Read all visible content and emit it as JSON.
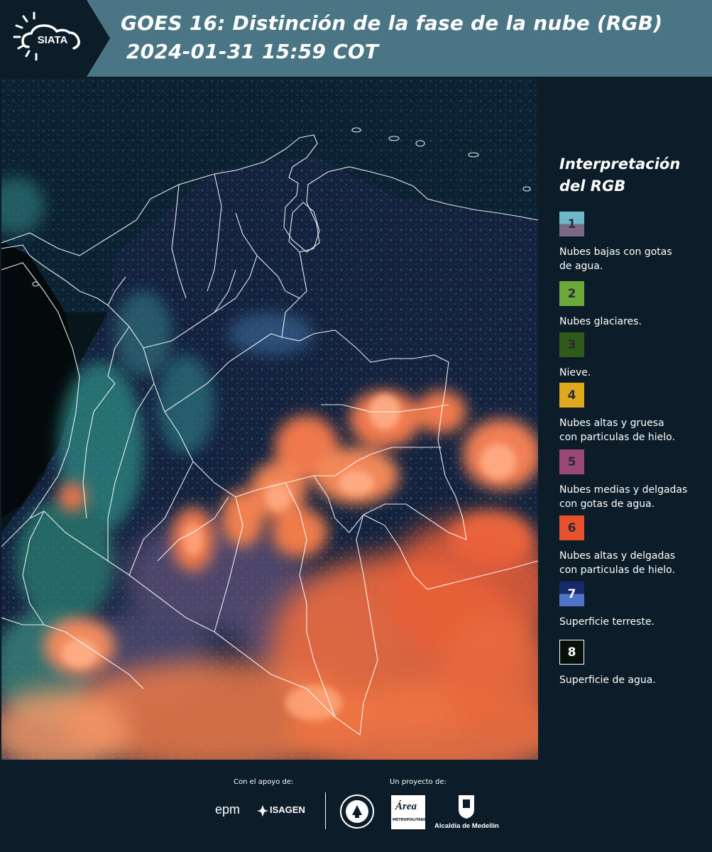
{
  "header": {
    "logo_text": "SIATA",
    "title_line1": "GOES 16: Distinción de la fase de la nube (RGB)",
    "title_line2": "2024-01-31 15:59 COT",
    "background_color": "#4a7585"
  },
  "legend": {
    "title_line1": "Interpretación",
    "title_line2": "del RGB",
    "items": [
      {
        "number": "1",
        "label_line1": "Nubes bajas con gotas",
        "label_line2": "de agua.",
        "colors": [
          "#6fb8c9",
          "#7b6a86"
        ]
      },
      {
        "number": "2",
        "label_line1": "Nubes glaciares.",
        "label_line2": "",
        "colors": [
          "#6aa93a"
        ]
      },
      {
        "number": "3",
        "label_line1": "Nieve.",
        "label_line2": "",
        "colors": [
          "#2f5a1c"
        ]
      },
      {
        "number": "4",
        "label_line1": "Nubes altas y gruesa",
        "label_line2": "con particulas de hielo.",
        "colors": [
          "#e0a81e"
        ]
      },
      {
        "number": "5",
        "label_line1": "Nubes medias y delgadas",
        "label_line2": "con gotas de agua.",
        "colors": [
          "#9b4877"
        ]
      },
      {
        "number": "6",
        "label_line1": "Nubes altas y delgadas",
        "label_line2": "con particulas de hielo.",
        "colors": [
          "#e4512b"
        ]
      },
      {
        "number": "7",
        "label_line1": "Superficie terreste.",
        "label_line2": "",
        "colors": [
          "#162a6a",
          "#4d74c9"
        ]
      },
      {
        "number": "8",
        "label_line1": "Superficie de agua.",
        "label_line2": "",
        "colors": [
          "#06110a"
        ]
      }
    ]
  },
  "footer": {
    "support_caption": "Con el apoyo de:",
    "project_caption": "Un proyecto de:",
    "epm_logo_text": "epm",
    "isagen_logo_text": "ISAGEN",
    "area_logo_text": "Área",
    "area_logo_subtext": "METROPOLITANA",
    "alcaldia_logo_text": "Alcaldía de Medellín"
  }
}
